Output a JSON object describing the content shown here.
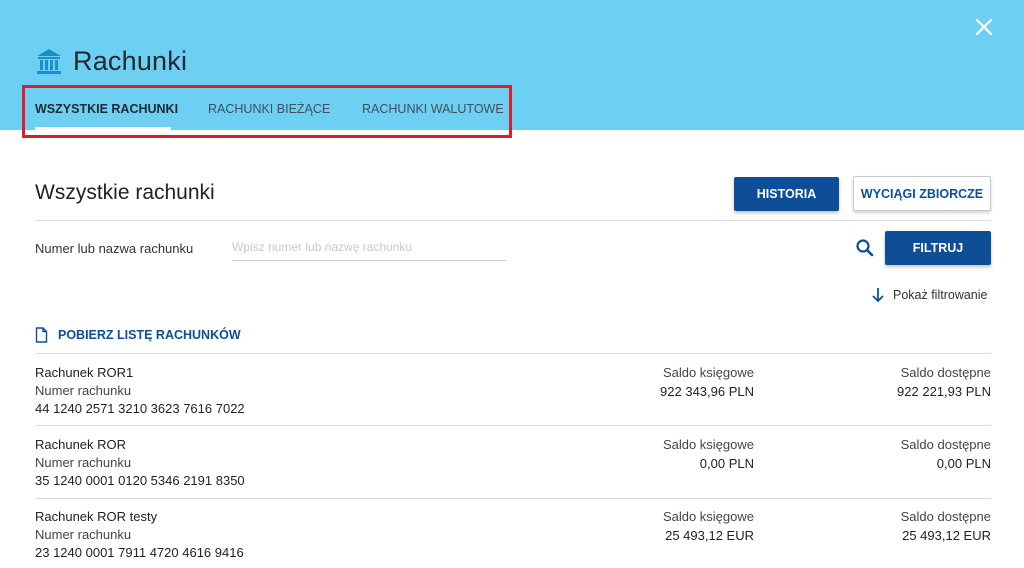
{
  "header": {
    "title": "Rachunki",
    "close_icon": "close-icon",
    "title_icon": "bank-icon",
    "background_color": "#6dcff2"
  },
  "tabs": [
    {
      "label": "WSZYSTKIE RACHUNKI",
      "active": true
    },
    {
      "label": "RACHUNKI BIEŻĄCE",
      "active": false
    },
    {
      "label": "RACHUNKI WALUTOWE",
      "active": false
    }
  ],
  "section": {
    "title": "Wszystkie rachunki",
    "history_button": "HISTORIA",
    "statements_button": "WYCIĄGI ZBIORCZE"
  },
  "filter": {
    "label": "Numer lub nazwa rachunku",
    "placeholder": "Wpisz numer lub nazwę rachunku",
    "value": "",
    "filter_button": "FILTRUJ",
    "show_filtering": "Pokaż filtrowanie"
  },
  "download_list": "POBIERZ LISTĘ RACHUNKÓW",
  "accounts": [
    {
      "name": "Rachunek ROR1",
      "number_label": "Numer rachunku",
      "number": "44 1240 2571 3210 3623 7616 7022",
      "book_label": "Saldo księgowe",
      "book_value": "922 343,96  PLN",
      "avail_label": "Saldo dostępne",
      "avail_value": "922 221,93  PLN"
    },
    {
      "name": "Rachunek ROR",
      "number_label": "Numer rachunku",
      "number": "35 1240 0001 0120 5346 2191 8350",
      "book_label": "Saldo księgowe",
      "book_value": "0,00  PLN",
      "avail_label": "Saldo dostępne",
      "avail_value": "0,00  PLN"
    },
    {
      "name": "Rachunek ROR testy",
      "number_label": "Numer rachunku",
      "number": "23 1240 0001 7911 4720 4616 9416",
      "book_label": "Saldo księgowe",
      "book_value": "25 493,12  EUR",
      "avail_label": "Saldo dostępne",
      "avail_value": "25 493,12  EUR"
    }
  ],
  "colors": {
    "primary": "#0d4e96",
    "highlight_border": "#d9202a"
  }
}
